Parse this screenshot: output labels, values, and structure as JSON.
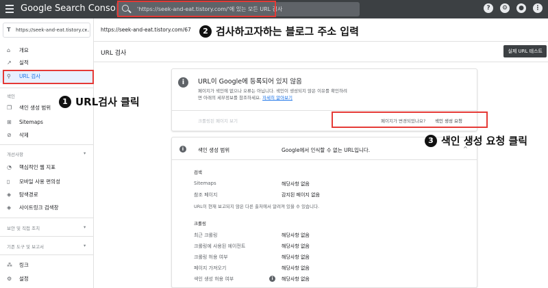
{
  "topbar": {
    "logo": "Google Search Console",
    "search_placeholder": "'https://seek-and-eat.tistory.com/'에 있는 모든 URL 검사",
    "icons": [
      "help-icon",
      "account-settings-icon",
      "notifications-icon",
      "apps-icon"
    ],
    "help_glyph": "?",
    "account_glyph": "⚙",
    "bell_glyph": "●",
    "apps_glyph": "⋮"
  },
  "sidebar": {
    "property_glyph": "T",
    "property": "https://seek-and-eat.tistory.c...",
    "property_caret": "▾",
    "items": [
      {
        "label": "개요",
        "icon": "home-icon",
        "glyph": "⌂"
      },
      {
        "label": "실적",
        "icon": "trending-icon",
        "glyph": "↗"
      },
      {
        "label": "URL 검사",
        "icon": "search-icon",
        "glyph": "⚲"
      },
      {
        "label": "색인 생성 범위",
        "icon": "coverage-icon",
        "glyph": "❐"
      },
      {
        "label": "Sitemaps",
        "icon": "sitemap-icon",
        "glyph": "⊞"
      },
      {
        "label": "삭제",
        "icon": "removal-icon",
        "glyph": "⊘"
      },
      {
        "label": "핵심적인 웹 지표",
        "icon": "speed-icon",
        "glyph": "◔"
      },
      {
        "label": "모바일 사용 편의성",
        "icon": "mobile-icon",
        "glyph": "▯"
      },
      {
        "label": "탐색경로",
        "icon": "breadcrumb-icon",
        "glyph": "◈"
      },
      {
        "label": "사이트링크 검색창",
        "icon": "sitelink-icon",
        "glyph": "◈"
      },
      {
        "label": "링크",
        "icon": "links-icon",
        "glyph": "⁂"
      },
      {
        "label": "설정",
        "icon": "settings-icon",
        "glyph": "⚙"
      }
    ],
    "sections": {
      "index": "색인",
      "enhancements": "개선사항",
      "security": "보안 및 직접 조치",
      "legacy": "기존 도구 및 보고서"
    },
    "section_chevron": "▾"
  },
  "url_bar": {
    "url": "https://seek-and-eat.tistory.com/67"
  },
  "page": {
    "title": "URL 검사",
    "live_test_button": "실제 URL 테스트"
  },
  "status_card": {
    "icon_glyph": "i",
    "title": "URL이 Google에 등록되어 있지 않음",
    "desc_line1": "페이지가 색인에 없으나 오류는 아닙니다. 색인이 생성되지 않은 이유를 확인하려",
    "desc_line2": "면 아래의 세부정보를 참조하세요.",
    "learn_more": "자세히 알아보기",
    "crawled_page": "크롤링된 페이지 보기",
    "changed_question": "페이지가 변경되었나요?",
    "request_indexing": "색인 생성 요청"
  },
  "coverage_card": {
    "icon_glyph": "i",
    "title": "색인 생성 범위",
    "status": "Google에서 인식할 수 없는 URL입니다.",
    "chevron": "^",
    "discovery_label": "검색",
    "rows_discovery": [
      {
        "label": "Sitemaps",
        "value": "해당사항 없음"
      },
      {
        "label": "참조 페이지",
        "value": "감지된 페이지 없음"
      }
    ],
    "discovery_note": "URL이 현재 보고되지 않은 다른 출처에서 알려져 있을 수 있습니다.",
    "crawl_label": "크롤링",
    "rows_crawl": [
      {
        "label": "최근 크롤링",
        "value": "해당사항 없음"
      },
      {
        "label": "크롤링에 사용된 에이전트",
        "value": "해당사항 없음"
      },
      {
        "label": "크롤링 허용 여부",
        "value": "해당사항 없음"
      },
      {
        "label": "페이지 가져오기",
        "value": "해당사항 없음"
      },
      {
        "label": "색인 생성 허용 여부",
        "value": "해당사항 없음"
      }
    ],
    "row_info_glyph": "i"
  },
  "annotations": [
    {
      "num": "1",
      "text": "URL검사 클릭"
    },
    {
      "num": "2",
      "text": "검사하고자하는 블로그 주소 입력"
    },
    {
      "num": "3",
      "text": "색인 생성 요청 클릭"
    }
  ],
  "colors": {
    "topbar": "#3c4043",
    "highlight": "#e53935",
    "link": "#1a73e8"
  }
}
